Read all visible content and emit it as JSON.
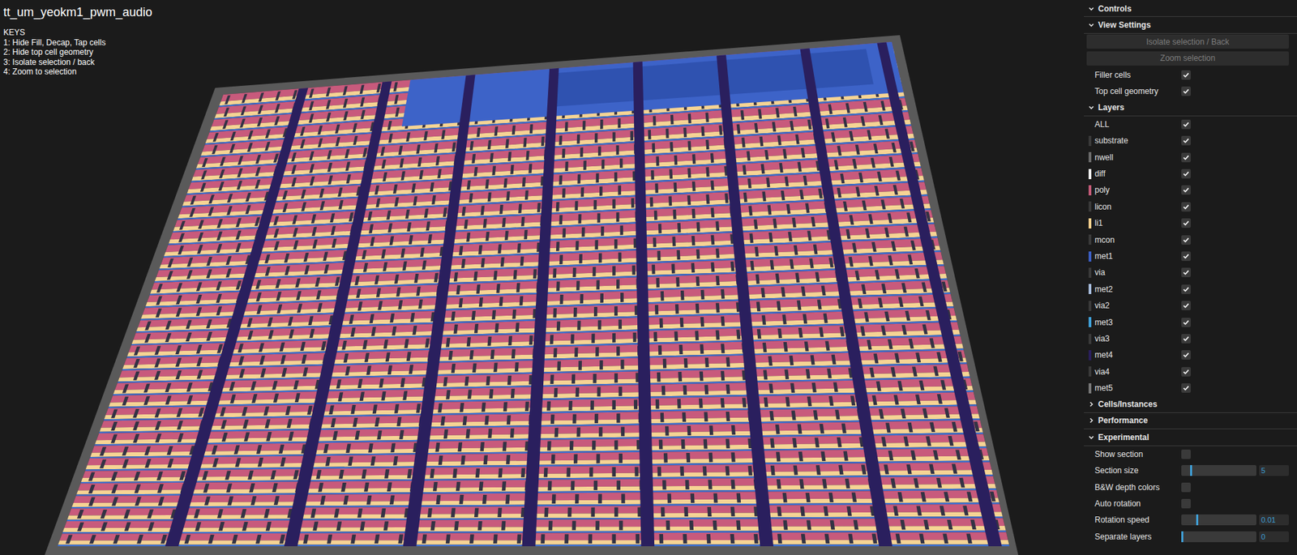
{
  "title": "tt_um_yeokm1_pwm_audio",
  "keys": {
    "heading": "KEYS",
    "items": [
      "1: Hide Fill, Decap, Tap cells",
      "2: Hide top cell geometry",
      "3: Isolate selection / back",
      "4: Zoom to selection"
    ]
  },
  "panel": {
    "root": {
      "label": "Controls",
      "expanded": true
    },
    "sections": [
      {
        "label": "View Settings",
        "expanded": true,
        "rows": [
          {
            "kind": "button",
            "label": "Isolate selection / Back",
            "disabled": true
          },
          {
            "kind": "button",
            "label": "Zoom selection",
            "disabled": true
          },
          {
            "kind": "checkbox",
            "label": "Filler cells",
            "checked": true
          },
          {
            "kind": "checkbox",
            "label": "Top cell geometry",
            "checked": true
          }
        ]
      },
      {
        "label": "Layers",
        "expanded": true,
        "rows": [
          {
            "kind": "checkbox",
            "label": "ALL",
            "checked": true
          },
          {
            "kind": "layer",
            "label": "substrate",
            "checked": true,
            "color": "#3a3a3a"
          },
          {
            "kind": "layer",
            "label": "nwell",
            "checked": true,
            "color": "#6b6b6b"
          },
          {
            "kind": "layer",
            "label": "diff",
            "checked": true,
            "color": "#f2f2f2"
          },
          {
            "kind": "layer",
            "label": "poly",
            "checked": true,
            "color": "#c45a78"
          },
          {
            "kind": "layer",
            "label": "licon",
            "checked": true,
            "color": "#3a3a3a"
          },
          {
            "kind": "layer",
            "label": "li1",
            "checked": true,
            "color": "#f6d08e"
          },
          {
            "kind": "layer",
            "label": "mcon",
            "checked": true,
            "color": "#3a3a3a"
          },
          {
            "kind": "layer",
            "label": "met1",
            "checked": true,
            "color": "#3b5fc4"
          },
          {
            "kind": "layer",
            "label": "via",
            "checked": true,
            "color": "#3a3a3a"
          },
          {
            "kind": "layer",
            "label": "met2",
            "checked": true,
            "color": "#a7bcdc"
          },
          {
            "kind": "layer",
            "label": "via2",
            "checked": true,
            "color": "#3a3a3a"
          },
          {
            "kind": "layer",
            "label": "met3",
            "checked": true,
            "color": "#3fa0d8"
          },
          {
            "kind": "layer",
            "label": "via3",
            "checked": true,
            "color": "#3a3a3a"
          },
          {
            "kind": "layer",
            "label": "met4",
            "checked": true,
            "color": "#2a1f5e"
          },
          {
            "kind": "layer",
            "label": "via4",
            "checked": true,
            "color": "#3a3a3a"
          },
          {
            "kind": "layer",
            "label": "met5",
            "checked": true,
            "color": "#777777"
          }
        ]
      },
      {
        "label": "Cells/Instances",
        "expanded": false,
        "rows": []
      },
      {
        "label": "Performance",
        "expanded": false,
        "rows": []
      },
      {
        "label": "Experimental",
        "expanded": true,
        "rows": [
          {
            "kind": "checkbox",
            "label": "Show section",
            "checked": false
          },
          {
            "kind": "slider",
            "label": "Section size",
            "level": 0.12,
            "reading": "5"
          },
          {
            "kind": "checkbox",
            "label": "B&W depth colors",
            "checked": false
          },
          {
            "kind": "checkbox",
            "label": "Auto rotation",
            "checked": false
          },
          {
            "kind": "slider",
            "label": "Rotation speed",
            "level": 0.2,
            "reading": "0.01"
          },
          {
            "kind": "slider",
            "label": "Separate layers",
            "level": 0,
            "reading": "0"
          }
        ]
      }
    ]
  }
}
